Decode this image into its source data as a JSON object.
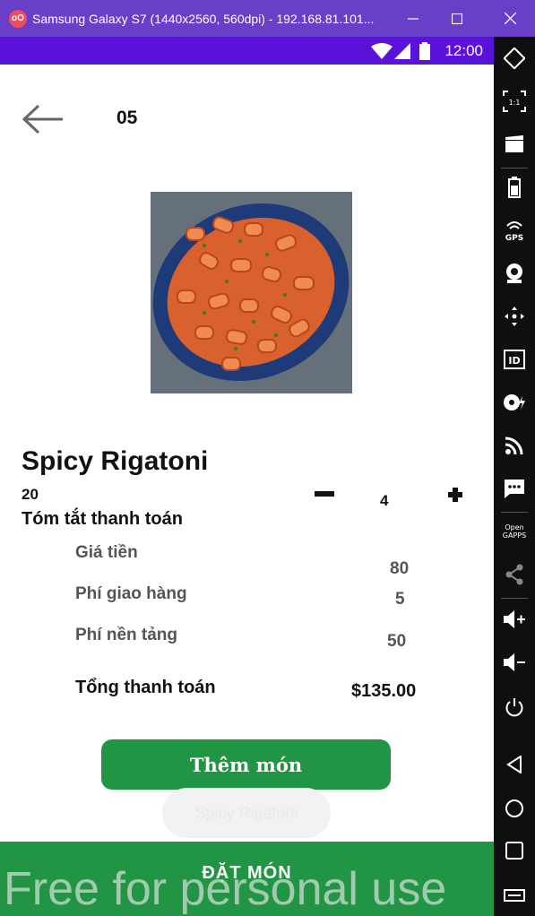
{
  "window": {
    "title": "Samsung Galaxy S7 (1440x2560, 560dpi) - 192.168.81.101...",
    "app_icon_text": "oO"
  },
  "statusbar": {
    "time": "12:00"
  },
  "header": {
    "table_number": "05"
  },
  "food": {
    "name": "Spicy Rigatoni",
    "price": "20",
    "quantity": "4"
  },
  "summary": {
    "title": "Tóm tắt thanh toán",
    "rows": [
      {
        "label": "Giá tiền",
        "value": "80"
      },
      {
        "label": "Phí giao hàng",
        "value": "5"
      },
      {
        "label": "Phí nền tảng",
        "value": "50"
      }
    ],
    "total_label": "Tổng thanh toán",
    "total_value": "$135.00"
  },
  "actions": {
    "add_item_label": "Thêm món",
    "order_label": "ĐẶT MÓN"
  },
  "toast": {
    "text": "Spicy Rigatoni"
  },
  "sidebar": {
    "items": [
      "rotate-icon",
      "fullscreen-icon",
      "video-icon",
      "battery-icon",
      "gps-icon",
      "camera-icon",
      "move-icon",
      "id-icon",
      "disk-icon",
      "rss-icon",
      "sms-icon",
      "opengapps-icon",
      "share-icon",
      "volume-up-icon",
      "volume-down-icon",
      "power-icon",
      "back-icon",
      "home-icon",
      "recents-icon",
      "menu-icon"
    ],
    "gps_label": "GPS",
    "id_label": "ID",
    "opengapps_label": "Open GAPPS",
    "fullscreen_label": "1:1"
  },
  "watermark": "Free for personal use",
  "colors": {
    "accent_green": "#229545",
    "title_purple": "#6a3fc7",
    "status_purple": "#5a12d9"
  }
}
